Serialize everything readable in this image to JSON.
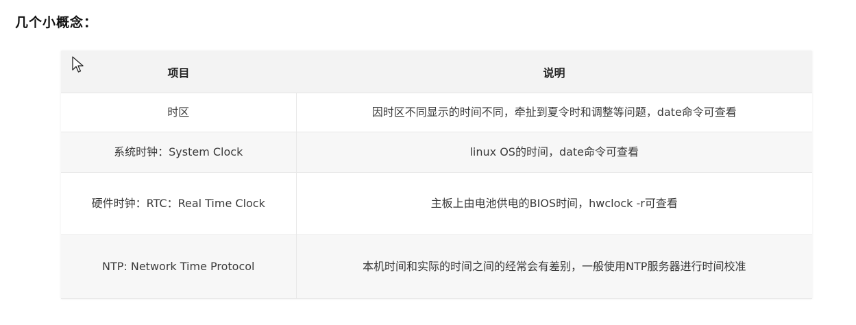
{
  "heading": "几个小概念：",
  "table": {
    "headers": [
      "项目",
      "说明"
    ],
    "rows": [
      [
        "时区",
        "因时区不同显示的时间不同，牵扯到夏令时和调整等问题，date命令可查看"
      ],
      [
        "系统时钟：System Clock",
        "linux OS的时间，date命令可查看"
      ],
      [
        "硬件时钟：RTC：Real Time Clock",
        "主板上由电池供电的BIOS时间，hwclock -r可查看"
      ],
      [
        "NTP: Network Time Protocol",
        "本机时间和实际的时间之间的经常会有差别，一般使用NTP服务器进行时间校准"
      ]
    ]
  },
  "cursor_icon": "mouse-pointer-icon"
}
